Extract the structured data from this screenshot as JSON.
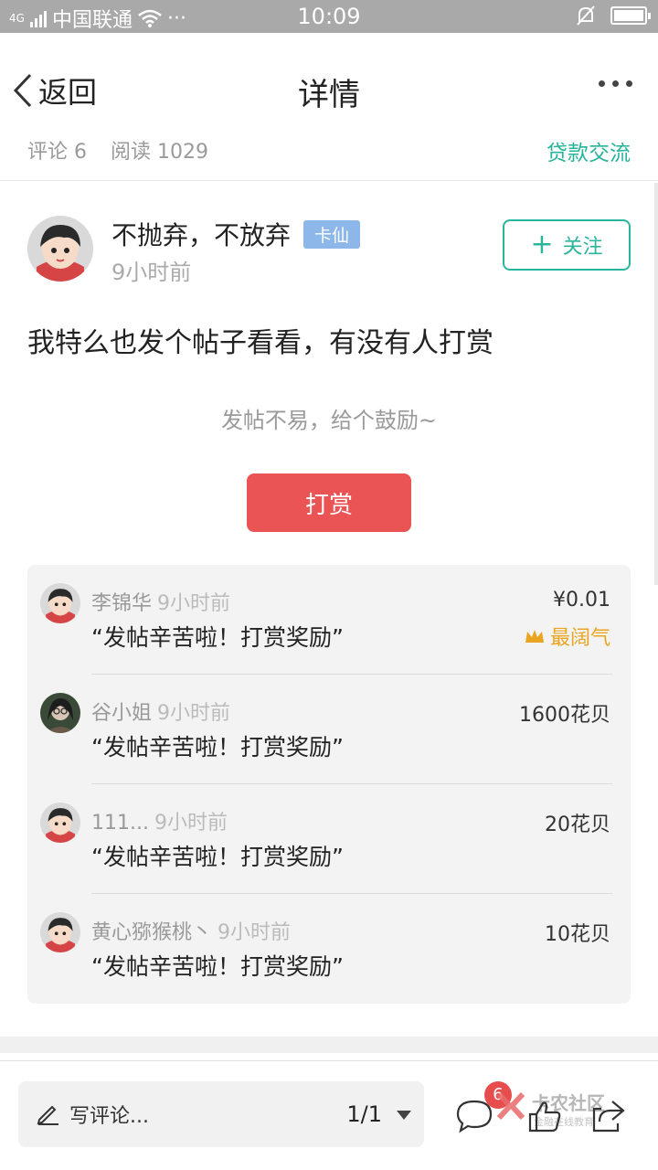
{
  "status_bar": {
    "network": "4G",
    "carrier": "中国联通",
    "time": "10:09",
    "more": "···"
  },
  "nav": {
    "back_label": "返回",
    "title": "详情"
  },
  "meta": {
    "comments": "评论 6",
    "reads": "阅读 1029",
    "category": "贷款交流"
  },
  "author": {
    "name": "不抛弃，不放弃",
    "tag": "卡仙",
    "time": "9小时前",
    "follow_label": "关注"
  },
  "post": {
    "text": "我特么也发个帖子看看，有没有人打赏",
    "reward_hint": "发帖不易，给个鼓励~",
    "reward_button": "打赏"
  },
  "rewards": [
    {
      "name": "李锦华",
      "time": "9小时前",
      "message": "“发帖辛苦啦！打赏奖励”",
      "amount": "¥0.01",
      "badge": "最阔气"
    },
    {
      "name": "谷小姐",
      "time": "9小时前",
      "message": "“发帖辛苦啦！打赏奖励”",
      "amount": "1600花贝"
    },
    {
      "name": "111...",
      "time": "9小时前",
      "message": "“发帖辛苦啦！打赏奖励”",
      "amount": "20花贝"
    },
    {
      "name": "黄心猕猴桃丶",
      "time": "9小时前",
      "message": "“发帖辛苦啦！打赏奖励”",
      "amount": "10花贝"
    }
  ],
  "bottom": {
    "comment_placeholder": "写评论...",
    "page": "1/1",
    "badge_count": "6",
    "watermark_title": "卡农社区",
    "watermark_sub": "金融在线教育"
  },
  "colors": {
    "accent": "#27b39a",
    "reward_red": "#ea5454",
    "tag_blue": "#8db7e8",
    "badge_gold": "#e9a520"
  }
}
